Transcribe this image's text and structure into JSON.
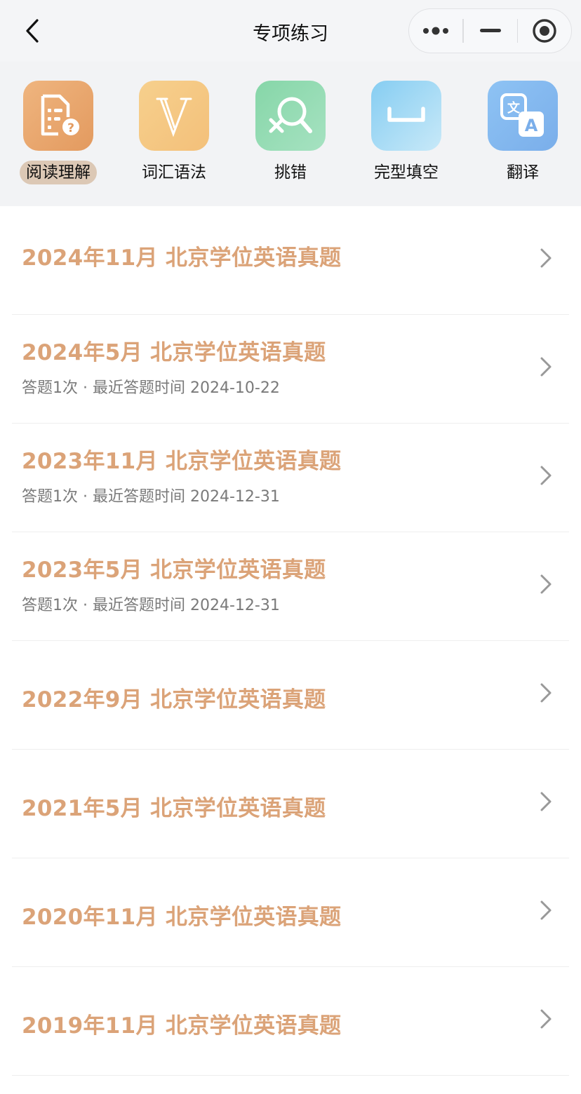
{
  "header": {
    "title": "专项练习",
    "back_icon": "chevron-left-icon",
    "capsule_icons": [
      "more-dots-icon",
      "minimize-icon",
      "close-target-icon"
    ]
  },
  "categories": [
    {
      "label": "阅读理解",
      "icon": "reading-doc-icon",
      "active": true,
      "color": "#e8a56d"
    },
    {
      "label": "词汇语法",
      "icon": "letter-v-icon",
      "active": false,
      "color": "#f5c983"
    },
    {
      "label": "挑错",
      "icon": "search-error-icon",
      "active": false,
      "color": "#8ed8b0"
    },
    {
      "label": "完型填空",
      "icon": "blank-bracket-icon",
      "active": false,
      "color": "#92d2f2"
    },
    {
      "label": "翻译",
      "icon": "translate-icon",
      "active": false,
      "color": "#86b8f0"
    }
  ],
  "list": [
    {
      "title": "2024年11月 北京学位英语真题",
      "sub": ""
    },
    {
      "title": "2024年5月 北京学位英语真题",
      "sub": "答题1次 · 最近答题时间 2024-10-22"
    },
    {
      "title": "2023年11月 北京学位英语真题",
      "sub": "答题1次 · 最近答题时间 2024-12-31"
    },
    {
      "title": "2023年5月 北京学位英语真题",
      "sub": "答题1次 · 最近答题时间 2024-12-31"
    },
    {
      "title": "2022年9月 北京学位英语真题",
      "sub": ""
    },
    {
      "title": "2021年5月 北京学位英语真题",
      "sub": ""
    },
    {
      "title": "2020年11月 北京学位英语真题",
      "sub": ""
    },
    {
      "title": "2019年11月 北京学位英语真题",
      "sub": ""
    }
  ],
  "colors": {
    "accent": "#dba378",
    "active_pill": "#dcc8b5",
    "subtext": "#7a7a7a"
  }
}
